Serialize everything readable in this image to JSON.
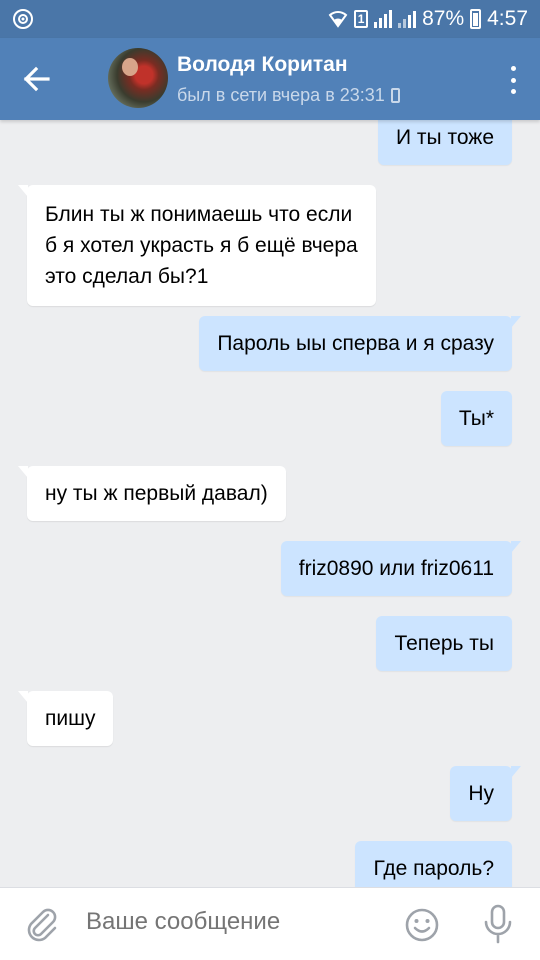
{
  "statusbar": {
    "battery": "87%",
    "time": "4:57",
    "sim_label": "1"
  },
  "header": {
    "name": "Володя Коритан",
    "status": "был в сети вчера в 23:31"
  },
  "messages": [
    {
      "dir": "out",
      "text": "И ты тоже"
    },
    {
      "dir": "in",
      "lines": [
        "Блин ты ж понимаешь что если",
        "б я хотел украсть я б ещё вчера",
        "это сделал бы?1"
      ]
    },
    {
      "dir": "out",
      "text": "Пароль ыы сперва и я сразу"
    },
    {
      "dir": "out",
      "text": "Ты*"
    },
    {
      "dir": "in",
      "text": "ну ты ж первый давал)"
    },
    {
      "dir": "out",
      "text": "friz0890 или friz0611"
    },
    {
      "dir": "out",
      "text": "Теперь ты"
    },
    {
      "dir": "in",
      "text": "пишу"
    },
    {
      "dir": "out",
      "text": "Ну"
    },
    {
      "dir": "out",
      "text": "Где пароль?"
    }
  ],
  "composer": {
    "placeholder": "Ваше сообщение"
  },
  "colors": {
    "header": "#5181b8",
    "statusbar": "#4a76a8",
    "bubble_out": "#cce4ff",
    "bubble_in": "#ffffff",
    "background": "#edeef0"
  },
  "icons": {
    "back": "arrow-left-icon",
    "menu": "more-vertical-icon",
    "attach": "paperclip-icon",
    "emoji": "smile-icon",
    "voice": "microphone-icon"
  }
}
